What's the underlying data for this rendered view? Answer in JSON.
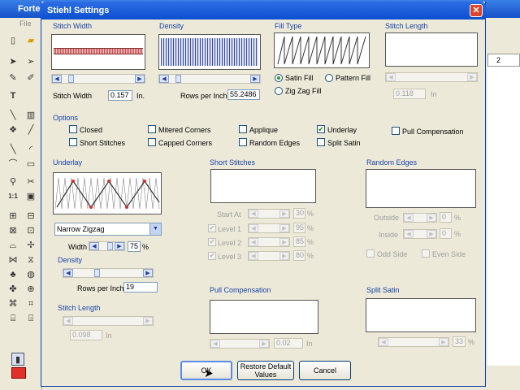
{
  "background": {
    "app_title": "Forte",
    "menu_file": "File"
  },
  "dialog": {
    "title": "Stiehl Settings",
    "close": "✕"
  },
  "stitch_width": {
    "label": "Stitch Width",
    "field_label": "Stitch Width",
    "value": "0.157",
    "unit": "In."
  },
  "density": {
    "label": "Density",
    "rows_label": "Rows per Inch",
    "value": "55.2486"
  },
  "fill_type": {
    "label": "Fill Type",
    "satin": "Satin Fill",
    "pattern": "Pattern Fill",
    "zigzag": "Zig Zag Fill",
    "selected": "Satin Fill"
  },
  "stitch_length": {
    "label": "Stitch Length",
    "value": "0.118",
    "unit": "In"
  },
  "options": {
    "label": "Options",
    "closed": "Closed",
    "mitered": "Mitered Corners",
    "applique": "Applique",
    "underlay": "Underlay",
    "pull_comp": "Pull Compensation",
    "short_stitches": "Short Stitches",
    "capped": "Capped Corners",
    "random_edges": "Random Edges",
    "split_satin": "Split Satin"
  },
  "underlay": {
    "label": "Underlay",
    "type": "Narrow Zigzag",
    "width_label": "Width",
    "width_value": "75",
    "pct": "%",
    "density_label": "Density",
    "rows_label": "Rows per Inch",
    "rows_value": "19",
    "stitch_length_label": "Stitch Length",
    "stitch_length_value": "0.098",
    "unit": "In"
  },
  "short_stitches": {
    "label": "Short Stitches",
    "start_at": "Start At",
    "start_value": "30",
    "level1": "Level 1",
    "level1_value": "95",
    "level2": "Level 2",
    "level2_value": "85",
    "level3": "Level 3",
    "level3_value": "80",
    "pct": "%"
  },
  "random_edges": {
    "label": "Random Edges",
    "outside": "Outside",
    "outside_value": "0",
    "inside": "Inside",
    "inside_value": "0",
    "odd_side": "Odd Side",
    "even_side": "Even Side",
    "pct": "%"
  },
  "pull_compensation": {
    "label": "Pull Compensation",
    "value": "0.02",
    "unit": "In"
  },
  "split_satin": {
    "label": "Split Satin",
    "value": "33",
    "pct": "%"
  },
  "buttons": {
    "ok": "OK",
    "restore": "Restore Default Values",
    "cancel": "Cancel"
  },
  "ruler": {
    "mark": "2"
  },
  "colors": {
    "title_blue": "#1652c8",
    "label_blue": "#1a44a8",
    "accent_red": "#e0302a"
  }
}
